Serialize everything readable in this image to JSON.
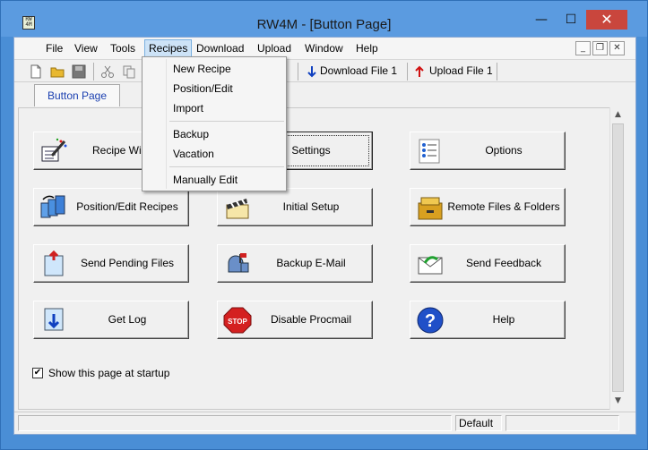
{
  "window": {
    "title": "RW4M - [Button Page]",
    "app_icon_text": "RW 4M",
    "minimize": "—",
    "maximize": "☐",
    "close": "✕"
  },
  "menubar": {
    "items": [
      "File",
      "View",
      "Tools",
      "Recipes",
      "Download",
      "Upload",
      "Window",
      "Help"
    ],
    "active": "Recipes",
    "mdi_minimize": "_",
    "mdi_restore": "❐",
    "mdi_close": "✕"
  },
  "toolbar": {
    "download_label": "Download File 1",
    "upload_label": "Upload File 1",
    "icons": [
      "new-file-icon",
      "open-folder-icon",
      "save-icon",
      "cut-icon",
      "copy-icon",
      "download-arrow-icon",
      "upload-arrow-icon"
    ]
  },
  "tabs": {
    "active_label": "Button Page"
  },
  "buttons": [
    {
      "label": "Recipe Wizard",
      "icon": "magic-wand-icon"
    },
    {
      "label": "Settings",
      "icon": "settings-icon"
    },
    {
      "label": "Options",
      "icon": "options-list-icon"
    },
    {
      "label": "Position/Edit Recipes",
      "icon": "position-edit-icon"
    },
    {
      "label": "Initial Setup",
      "icon": "clapperboard-icon"
    },
    {
      "label": "Remote Files & Folders",
      "icon": "file-cabinet-icon"
    },
    {
      "label": "Send Pending Files",
      "icon": "send-file-icon"
    },
    {
      "label": "Backup E-Mail",
      "icon": "mailbox-icon"
    },
    {
      "label": "Send Feedback",
      "icon": "feedback-envelope-icon"
    },
    {
      "label": "Get Log",
      "icon": "get-log-icon"
    },
    {
      "label": "Disable Procmail",
      "icon": "stop-sign-icon"
    },
    {
      "label": "Help",
      "icon": "help-icon"
    }
  ],
  "stop_sign_text": "STOP",
  "startup_checkbox": {
    "label": "Show this page at startup",
    "checked": true
  },
  "statusbar": {
    "mode": "Default"
  },
  "recipes_menu": {
    "items": [
      "New Recipe",
      "Position/Edit",
      "Import",
      "Backup",
      "Vacation",
      "Manually Edit"
    ]
  },
  "colors": {
    "title_bar": "#5b9be0",
    "close_button": "#c9463d",
    "tab_text": "#1a3fb0",
    "menu_highlight": "#cde3f7"
  }
}
